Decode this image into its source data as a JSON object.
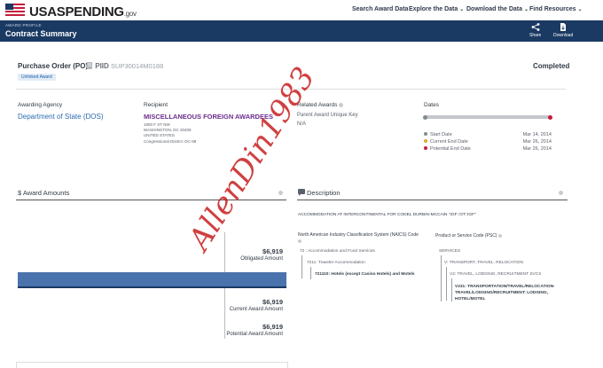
{
  "nav": {
    "logo_main": "USASPENDING",
    "logo_suffix": ".gov",
    "items": [
      {
        "label": "Search Award Data",
        "has_menu": false
      },
      {
        "label": "Explore the Data",
        "has_menu": true
      },
      {
        "label": "Download the Data",
        "has_menu": true
      },
      {
        "label": "Find Resources",
        "has_menu": true
      }
    ]
  },
  "header": {
    "eyebrow": "AWARD PROFILE",
    "title": "Contract Summary",
    "share_label": "Share",
    "download_label": "Download"
  },
  "award": {
    "type": "Purchase Order (PO)",
    "piid_label": "PIID",
    "piid": "SUP30014M0188",
    "status": "Completed",
    "badge": "Unlinked Award"
  },
  "agency": {
    "label": "Awarding Agency",
    "name": "Department of State (DOS)"
  },
  "recipient": {
    "label": "Recipient",
    "name": "MISCELLANEOUS FOREIGN AWARDEES",
    "addr1": "1800 F ST NW",
    "addr2": "WASHINGTON, DC 20405",
    "addr3": "UNITED STATES",
    "district": "Congressional District: DC-98"
  },
  "related": {
    "label": "Related Awards",
    "key_label": "Parent Award Unique Key",
    "key_value": "N/A"
  },
  "dates": {
    "label": "Dates",
    "progress_fraction": 1.0,
    "rows": [
      {
        "label": "Start Date",
        "value": "Mar 14, 2014",
        "color": "#7f8c8d"
      },
      {
        "label": "Current End Date",
        "value": "Mar 26, 2014",
        "color": "#e0a82e"
      },
      {
        "label": "Potential End Date",
        "value": "Mar 26, 2014",
        "color": "#c41e3a"
      }
    ]
  },
  "amounts": {
    "title": "$ Award Amounts",
    "obligated_value": "$6,919",
    "obligated_label": "Obligated Amount",
    "current_value": "$6,919",
    "current_label": "Current Award Amount",
    "potential_value": "$6,919",
    "potential_label": "Potential Award Amount",
    "bar_color": "#4a73ad"
  },
  "description": {
    "title": "Description",
    "text": "ACCOMMODATION AT INTERCONTINENTAL FOR CODEL DURBIN-MCCAIN  \"IGF::OT::IGF\"",
    "naics_label": "North American Industry Classification System (NAICS) Code",
    "naics_tree": [
      "72 : Accommodation and Food Services",
      "7211: Traveler Accommodation",
      "721110: Hotels (except Casino Hotels) and Motels"
    ],
    "psc_label": "Product or Service Code (PSC)",
    "psc_tree": [
      "SERVICES",
      "V: TRANSPORT, TRAVEL, RELOCATION",
      "V2: TRAVEL, LODGING, RECRUITMENT SVCS",
      "V231: TRANSPORTATION/TRAVEL/RELOCATION-TRAVEL/LODGING/RECRUITMENT: LODGING, HOTEL/MOTEL"
    ]
  },
  "watermark": "AllenDin1983"
}
